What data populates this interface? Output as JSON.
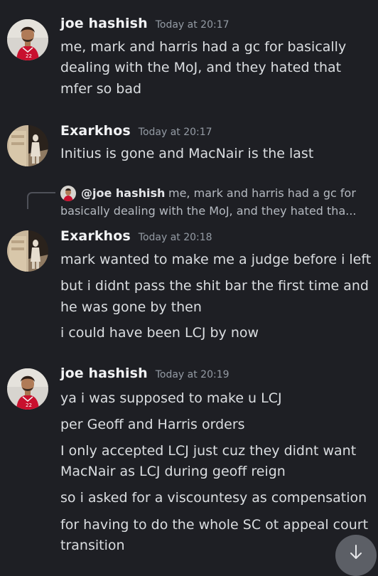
{
  "messages": [
    {
      "author": "joe hashish",
      "time": "Today at 20:17",
      "avatar_icon": "footballer-avatar",
      "lines": [
        "me, mark and harris had a gc for basically",
        "dealing with the MoJ, and they hated that",
        "mfer so bad"
      ]
    },
    {
      "author": "Exarkhos",
      "time": "Today at 20:17",
      "avatar_icon": "statue-avatar",
      "lines": [
        "Initius is gone and MacNair is the last"
      ]
    },
    {
      "author": "Exarkhos",
      "time": "Today at 20:18",
      "avatar_icon": "statue-avatar",
      "reply": {
        "mention": "@joe hashish",
        "preview_line1": "me, mark and harris had a gc for",
        "preview_line2": "basically dealing with the MoJ, and they hated tha..."
      },
      "lines": [
        "mark wanted to make me a judge before i left",
        "but i didnt pass the shit bar the first time and",
        "he was gone by then",
        "i could have been LCJ by now"
      ]
    },
    {
      "author": "joe hashish",
      "time": "Today at 20:19",
      "avatar_icon": "footballer-avatar",
      "lines": [
        "ya i was supposed to make u LCJ",
        "per Geoff and Harris orders",
        "I only accepted LCJ just cuz they didnt want",
        "MacNair as LCJ during geoff reign",
        "so i asked for a viscountesy as compensation",
        "for having to do the whole SC ot appeal court",
        "transition"
      ]
    }
  ],
  "jump_button_icon": "arrow-down-icon"
}
